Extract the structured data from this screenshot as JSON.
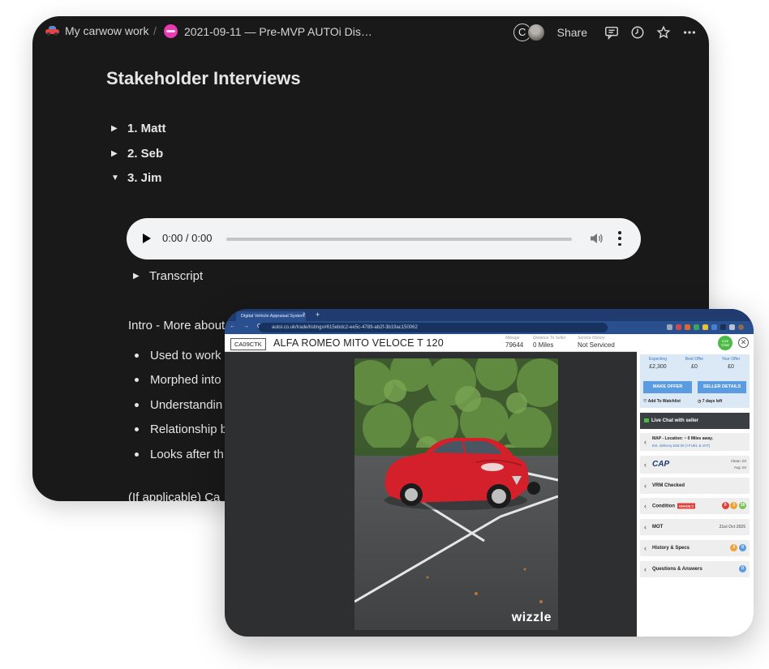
{
  "notion": {
    "breadcrumb_workspace": "My carwow work",
    "breadcrumb_sep": "/",
    "breadcrumb_page": "2021-09-11 — Pre-MVP AUTOi Dis…",
    "avatar_initial": "C",
    "share_label": "Share",
    "title": "Stakeholder Interviews",
    "toggles": [
      {
        "label": "1. Matt",
        "expanded": false
      },
      {
        "label": "2. Seb",
        "expanded": false
      },
      {
        "label": "3. Jim",
        "expanded": true
      }
    ],
    "audio_time": "0:00 / 0:00",
    "transcript_label": "Transcript",
    "intro": "Intro - More about",
    "bullets": [
      "Used to work",
      "Morphed into",
      "Understandin",
      "Relationship b",
      "Looks after th"
    ],
    "if_applicable": "(If applicable) Ca"
  },
  "browser": {
    "tab_title": "Digital Vehicle Appraisal System",
    "tab_close": "×",
    "new_tab": "+",
    "nav": "← → C",
    "url": "autoi.co.uk/trade/listings#615ebdc2-ee5c-4789-ab2f-3b19ac150062",
    "plate": "CA09CTK",
    "car_name": "ALFA ROMEO MITO VELOCE T 120",
    "stats": [
      {
        "label": "Mileage",
        "value": "79644"
      },
      {
        "label": "Distance To Seller",
        "value": "0 Miles"
      },
      {
        "label": "Service History",
        "value": "Not Serviced"
      }
    ],
    "photo_watermark": "wizzle",
    "live_chat_bubble": "Live Chat",
    "close_icon_glyph": "✕",
    "offer": {
      "cols": [
        {
          "label": "Expecting",
          "value": "£2,300"
        },
        {
          "label": "Best Offer",
          "value": "£0"
        },
        {
          "label": "Your Offer",
          "value": "£0"
        }
      ],
      "make_offer": "MAKE OFFER",
      "seller_details": "SELLER DETAILS",
      "watchlist": "Add To Watchlist",
      "days_left": "7 days left"
    },
    "live_chat": "Live Chat with seller",
    "rows": {
      "map_title": "MAP - Location: ~ 0 Miles away.",
      "map_sub": "Est. delivery £60.00 (+FUEL & VAT)",
      "cap": "CAP",
      "cap_clean": "Clean: £0",
      "cap_avg": "Avg: £0",
      "vrm": "VRM Checked",
      "condition": "Condition",
      "grade": "GRADE 5",
      "cond_badges": [
        "0",
        "1",
        "16"
      ],
      "mot": "MOT",
      "mot_date": "21st Oct 2025",
      "history": "History & Specs",
      "history_badges": [
        "2",
        "0"
      ],
      "qa": "Questions & Answers",
      "qa_badge": "0"
    },
    "colors": {
      "tabbar": "#1f3b70",
      "urlbar": "#2a4f8f",
      "car_red": "#d3202a",
      "live_green": "#4cbb46",
      "button_blue": "#5b9be0"
    }
  }
}
